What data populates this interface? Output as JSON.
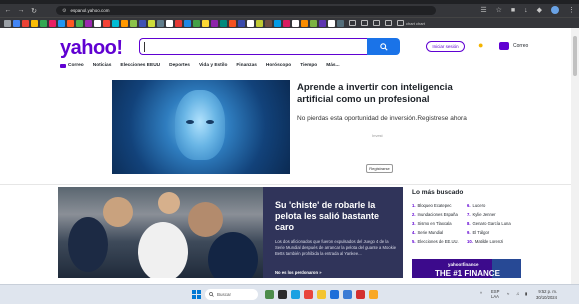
{
  "browser": {
    "url": "espanol.yahoo.com",
    "bookmark_label": "chart chart"
  },
  "header": {
    "logo": "yahoo!",
    "signin_label": "Iniciar sesión",
    "mail_label": "Correo"
  },
  "nav": {
    "items": [
      "Correo",
      "Noticias",
      "Elecciones EEUU",
      "Deportes",
      "Vida y Estilo",
      "Finanzas",
      "Horóscopo",
      "Tiempo",
      "Más..."
    ]
  },
  "ad": {
    "title": "Aprende a invertir con inteligencia artificial como un profesional",
    "description": "No pierdas esta oportunidad de inversión.Registrese ahora",
    "small": "Invest",
    "cta": "Registrarse"
  },
  "story": {
    "title": "Su 'chiste' de robarle la pelota les salió bastante caro",
    "body": "Los dos aficionados que fueron expulsados del Juego 4 de la Serie Mundial después de arrancar la pelota del guante a Mookie Betts también prohibida la entrada al Yankee...",
    "more": "No es los perdonaron »"
  },
  "trending": {
    "title": "Lo más buscado",
    "items": [
      {
        "num": "1.",
        "label": "Bloqueo Ecatepec"
      },
      {
        "num": "2.",
        "label": "Inundaciones España"
      },
      {
        "num": "3.",
        "label": "Sismo en Tlaxcala"
      },
      {
        "num": "4.",
        "label": "Serie Mundial"
      },
      {
        "num": "5.",
        "label": "Elecciones de EE.UU."
      },
      {
        "num": "6.",
        "label": "Lucero"
      },
      {
        "num": "7.",
        "label": "Kylie Jenner"
      },
      {
        "num": "8.",
        "label": "Genaro García Luna"
      },
      {
        "num": "9.",
        "label": "El Tálgor"
      },
      {
        "num": "10.",
        "label": "Matilde Lorenzi"
      }
    ]
  },
  "finance": {
    "logo": "yahoo!finance",
    "headline": "THE #1 FINANCE"
  },
  "taskbar": {
    "search_label": "Buscar",
    "lang": "ESP\nLAA",
    "time": "9:52 p. m.",
    "date": "30/10/2024"
  }
}
